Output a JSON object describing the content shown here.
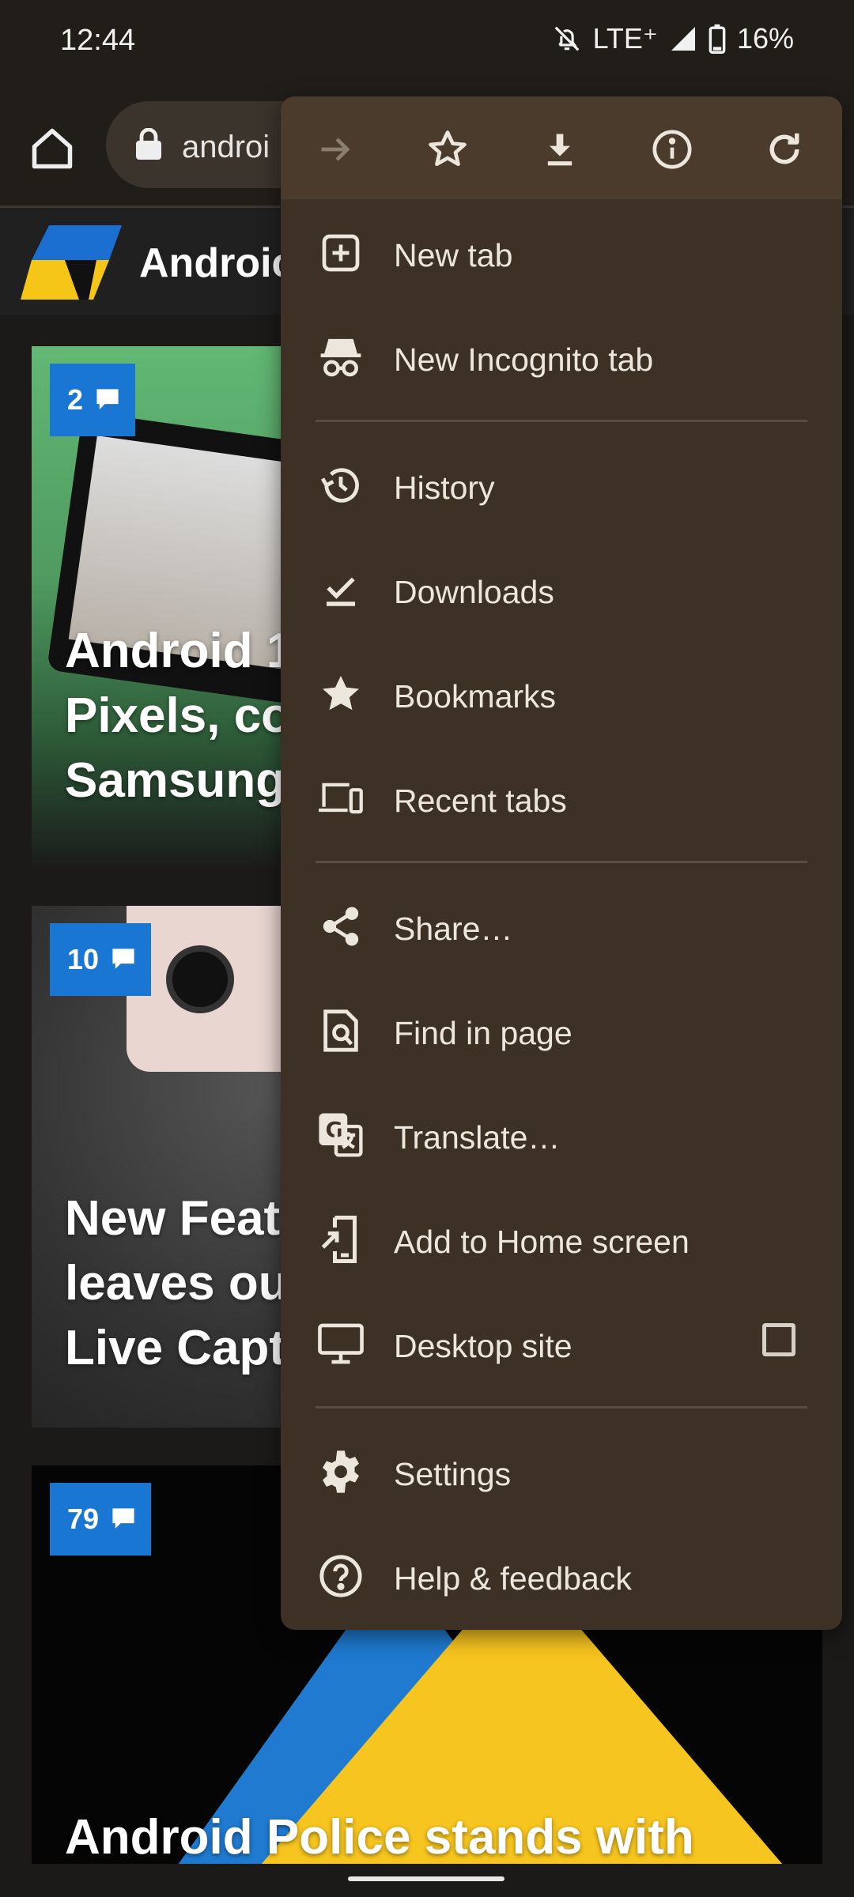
{
  "status_bar": {
    "time": "12:44",
    "network": "LTE⁺",
    "battery": "16%",
    "icons": [
      "bell-off-icon",
      "signal-icon",
      "battery-icon"
    ]
  },
  "browser": {
    "url_partial": "androi",
    "site_name": "Androic"
  },
  "feed": {
    "cards": [
      {
        "comments": "2",
        "title": "Android 1\nPixels, co\nSamsung"
      },
      {
        "comments": "10",
        "title": "New Feat\nleaves ou\nLive Capt"
      },
      {
        "comments": "79",
        "title": "Android Police stands with"
      }
    ]
  },
  "menu": {
    "top_actions": [
      "forward-icon",
      "bookmark-star-icon",
      "download-icon",
      "page-info-icon",
      "reload-icon"
    ],
    "items": [
      {
        "label": "New tab",
        "icon": "new-tab-icon"
      },
      {
        "label": "New Incognito tab",
        "icon": "incognito-icon"
      },
      {
        "label": "History",
        "icon": "history-icon"
      },
      {
        "label": "Downloads",
        "icon": "downloads-icon"
      },
      {
        "label": "Bookmarks",
        "icon": "bookmarks-icon"
      },
      {
        "label": "Recent tabs",
        "icon": "recent-tabs-icon"
      },
      {
        "label": "Share…",
        "icon": "share-icon"
      },
      {
        "label": "Find in page",
        "icon": "find-in-page-icon"
      },
      {
        "label": "Translate…",
        "icon": "translate-icon"
      },
      {
        "label": "Add to Home screen",
        "icon": "add-to-home-icon"
      },
      {
        "label": "Desktop site",
        "icon": "desktop-icon"
      },
      {
        "label": "Settings",
        "icon": "settings-icon"
      },
      {
        "label": "Help & feedback",
        "icon": "help-icon"
      }
    ],
    "desktop_site_checked": false
  },
  "colors": {
    "menu_bg": "#3d3125",
    "menu_top_bg": "#4a3b2c",
    "badge_blue": "#1976d2",
    "page_bg": "#1b1a18"
  }
}
